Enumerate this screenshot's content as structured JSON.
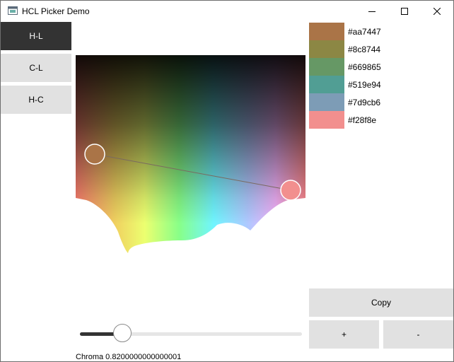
{
  "window": {
    "title": "HCL Picker Demo",
    "controls": [
      "minimize-icon",
      "maximize-icon",
      "close-icon"
    ]
  },
  "modes": [
    {
      "label": "H-L",
      "active": true
    },
    {
      "label": "C-L",
      "active": false
    },
    {
      "label": "H-C",
      "active": false
    }
  ],
  "palette": [
    {
      "hex": "#aa7447"
    },
    {
      "hex": "#8c8744"
    },
    {
      "hex": "#669865"
    },
    {
      "hex": "#519e94"
    },
    {
      "hex": "#7d9cb6"
    },
    {
      "hex": "#f28f8e"
    }
  ],
  "actions": {
    "copy": "Copy",
    "add": "+",
    "remove": "-"
  },
  "slider": {
    "label": "Chroma 0.8200000000000001",
    "value": 0.82,
    "fraction": 0.19
  },
  "colors": {
    "accent": "#333333",
    "button": "#e1e1e1",
    "pin_start": "#aa7447",
    "pin_end": "#f28f8e"
  }
}
